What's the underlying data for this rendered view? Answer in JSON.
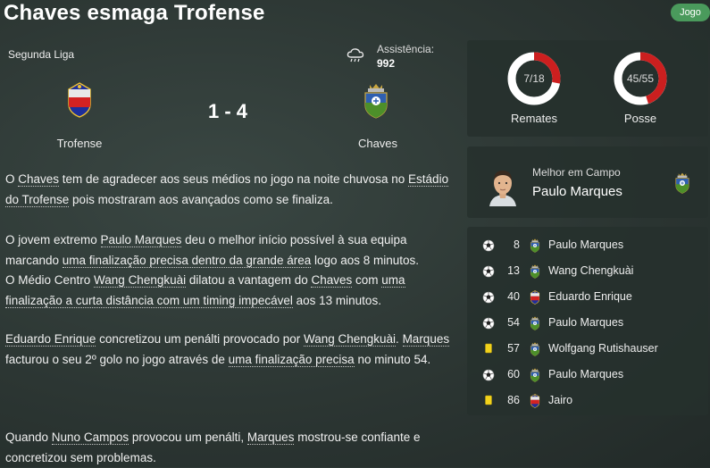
{
  "header": {
    "title": "Chaves esmaga Trofense",
    "jogo_label": "Jogo"
  },
  "match": {
    "league": "Segunda Liga",
    "weather_icon": "rain-cloud-icon",
    "attendance_label": "Assistência:",
    "attendance_value": "992",
    "home_team": "Trofense",
    "away_team": "Chaves",
    "score": "1 - 4"
  },
  "report": {
    "p1": [
      "O ",
      {
        "l": "Chaves"
      },
      " tem de agradecer aos seus médios no jogo na noite chuvosa no ",
      {
        "l": "Estádio do Trofense"
      },
      " pois mostraram aos avançados como se finaliza."
    ],
    "p2": [
      "O jovem extremo ",
      {
        "l": "Paulo Marques"
      },
      " deu o melhor início possível à sua equipa marcando ",
      {
        "l": "uma finalização precisa dentro da grande área"
      },
      " logo aos 8 minutos."
    ],
    "p3": [
      "O Médio Centro ",
      {
        "l": "Wang Chengkuài"
      },
      " dilatou a vantagem do ",
      {
        "l": "Chaves"
      },
      " com ",
      {
        "l": "uma finalização a curta distância com um timing impecável"
      },
      " aos 13 minutos."
    ],
    "p4": [
      {
        "l": "Eduardo Enrique"
      },
      " concretizou um penálti provocado por ",
      {
        "l": "Wang Chengkuài"
      },
      ". ",
      {
        "l": "Marques"
      },
      " facturou o seu 2º golo no jogo através de ",
      {
        "l": "uma finalização precisa"
      },
      " no minuto 54."
    ],
    "p5": [
      "Quando ",
      {
        "l": "Nuno Campos"
      },
      " provocou um penálti, ",
      {
        "l": "Marques"
      },
      " mostrou-se confiante e concretizou sem problemas."
    ]
  },
  "stats": {
    "shots": {
      "label": "Remates",
      "text": "7/18",
      "home": 7,
      "away": 18
    },
    "possession": {
      "label": "Posse",
      "text": "45/55",
      "home": 45,
      "away": 55
    },
    "home_color": "#cc1f1f",
    "away_color": "#ffffff"
  },
  "motm": {
    "title": "Melhor em Campo",
    "name": "Paulo Marques"
  },
  "events": [
    {
      "icon": "ball-icon",
      "minute": "8",
      "team": "chaves",
      "player": "Paulo Marques"
    },
    {
      "icon": "ball-icon",
      "minute": "13",
      "team": "chaves",
      "player": "Wang Chengkuài"
    },
    {
      "icon": "ball-icon",
      "minute": "40",
      "team": "trofense",
      "player": "Eduardo Enrique"
    },
    {
      "icon": "ball-icon",
      "minute": "54",
      "team": "chaves",
      "player": "Paulo Marques"
    },
    {
      "icon": "yellow-card-icon",
      "minute": "57",
      "team": "chaves",
      "player": "Wolfgang Rutishauser"
    },
    {
      "icon": "ball-icon",
      "minute": "60",
      "team": "chaves",
      "player": "Paulo Marques"
    },
    {
      "icon": "yellow-card-icon",
      "minute": "86",
      "team": "trofense",
      "player": "Jairo"
    }
  ]
}
